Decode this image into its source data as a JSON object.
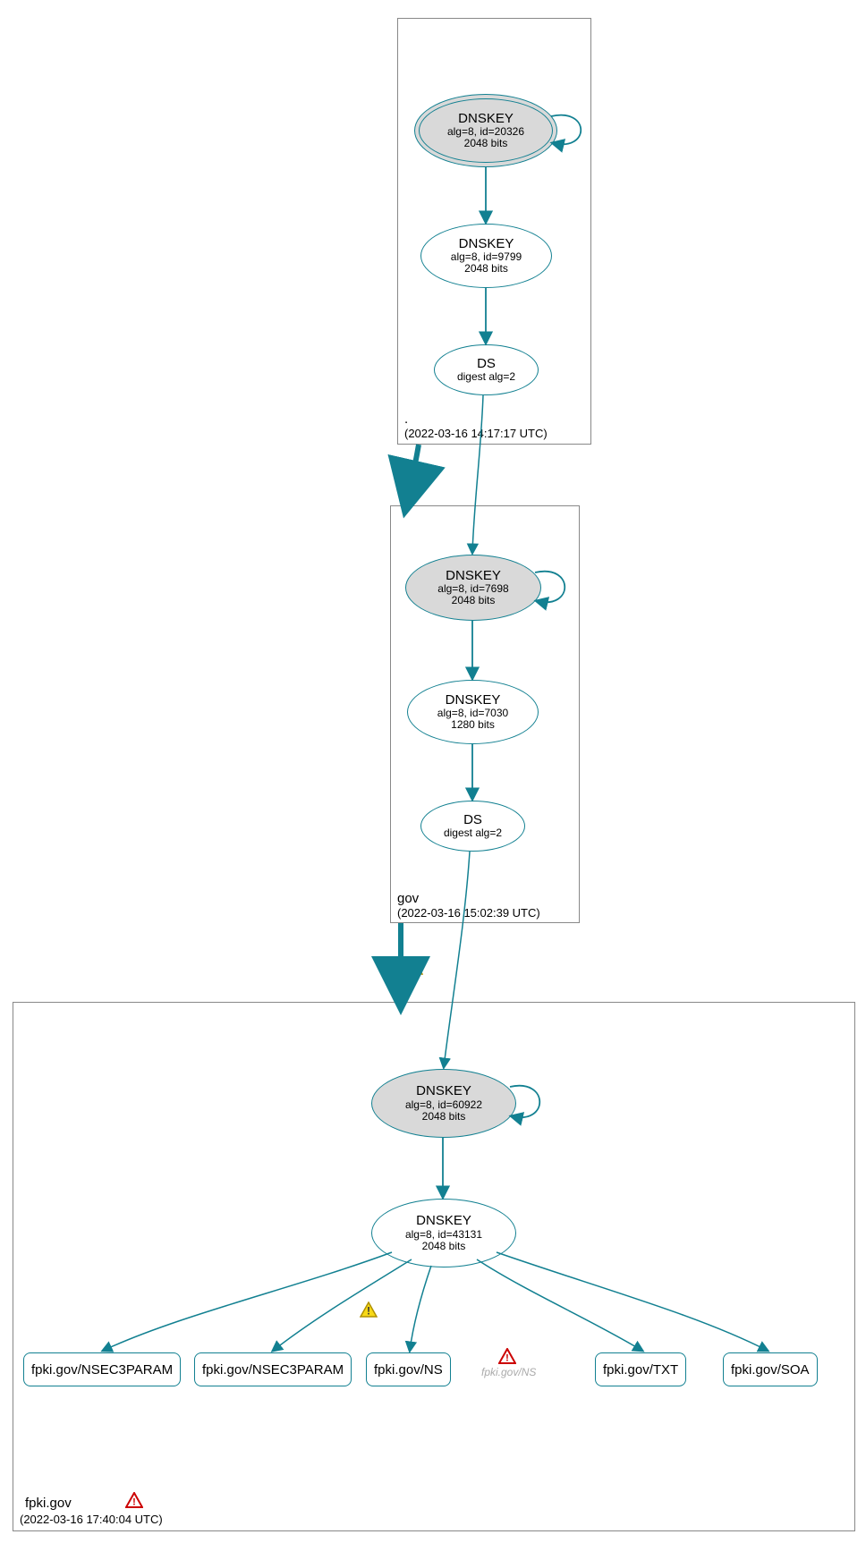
{
  "colors": {
    "stroke": "#128091",
    "box": "#888888",
    "fill_grey": "#d9d9d9",
    "warn_fill": "#f7d917",
    "warn_stroke": "#b09000",
    "err_stroke": "#cc0000"
  },
  "zones": {
    "root": {
      "name": ".",
      "timestamp": "(2022-03-16 14:17:17 UTC)"
    },
    "gov": {
      "name": "gov",
      "timestamp": "(2022-03-16 15:02:39 UTC)"
    },
    "fpki": {
      "name": "fpki.gov",
      "timestamp": "(2022-03-16 17:40:04 UTC)"
    }
  },
  "nodes": {
    "root_ksk": {
      "title": "DNSKEY",
      "line1": "alg=8, id=20326",
      "line2": "2048 bits"
    },
    "root_zsk": {
      "title": "DNSKEY",
      "line1": "alg=8, id=9799",
      "line2": "2048 bits"
    },
    "root_ds": {
      "title": "DS",
      "line1": "digest alg=2",
      "line2": ""
    },
    "gov_ksk": {
      "title": "DNSKEY",
      "line1": "alg=8, id=7698",
      "line2": "2048 bits"
    },
    "gov_zsk": {
      "title": "DNSKEY",
      "line1": "alg=8, id=7030",
      "line2": "1280 bits"
    },
    "gov_ds": {
      "title": "DS",
      "line1": "digest alg=2",
      "line2": ""
    },
    "fpki_ksk": {
      "title": "DNSKEY",
      "line1": "alg=8, id=60922",
      "line2": "2048 bits"
    },
    "fpki_zsk": {
      "title": "DNSKEY",
      "line1": "alg=8, id=43131",
      "line2": "2048 bits"
    }
  },
  "records": {
    "r1": "fpki.gov/NSEC3PARAM",
    "r2": "fpki.gov/NSEC3PARAM",
    "r3": "fpki.gov/NS",
    "r4": "fpki.gov/NS",
    "r5": "fpki.gov/TXT",
    "r6": "fpki.gov/SOA"
  }
}
